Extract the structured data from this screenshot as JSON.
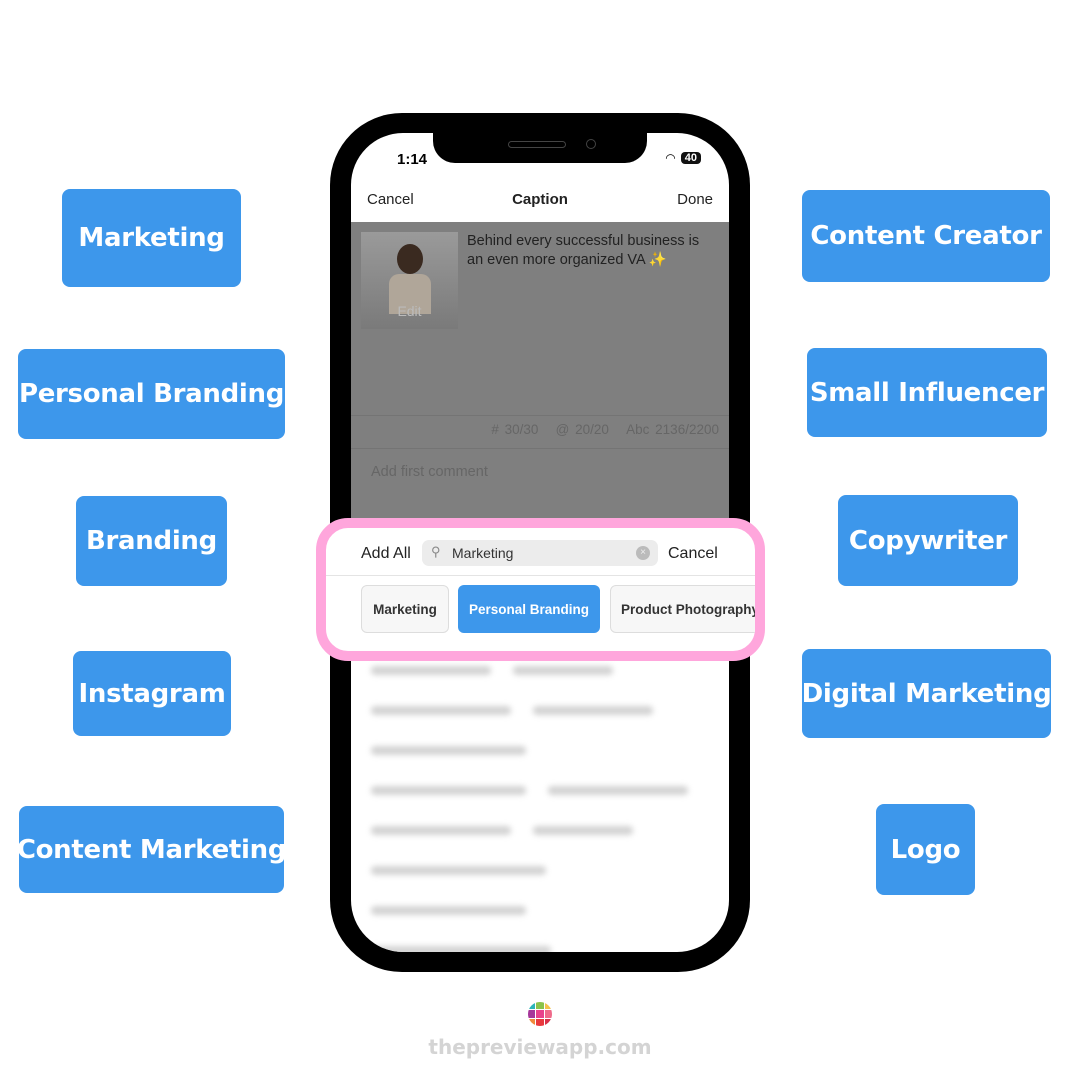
{
  "left_tags": [
    "Marketing",
    "Personal Branding",
    "Branding",
    "Instagram",
    "Content Marketing"
  ],
  "right_tags": [
    "Content Creator",
    "Small Influencer",
    "Copywriter",
    "Digital Marketing",
    "Logo"
  ],
  "status": {
    "time": "1:14",
    "battery": "40"
  },
  "nav": {
    "cancel": "Cancel",
    "title": "Caption",
    "done": "Done"
  },
  "post": {
    "caption": "Behind every successful business is an even more organized VA ✨",
    "edit": "Edit"
  },
  "counts": {
    "hashtags": "# 30/30",
    "mentions": "@ 20/20",
    "chars": "Abc 2136/2200"
  },
  "comment_placeholder": "Add first comment",
  "search": {
    "add_all": "Add All",
    "value": "Marketing",
    "cancel": "Cancel"
  },
  "chips": [
    {
      "label": "Marketing",
      "selected": false
    },
    {
      "label": "Personal Branding",
      "selected": true
    },
    {
      "label": "Product Photography",
      "selected": false
    }
  ],
  "footer": {
    "site": "thepreviewapp.com"
  },
  "colors": {
    "tag": "#3d97eb",
    "highlight": "#ffa6dc"
  }
}
